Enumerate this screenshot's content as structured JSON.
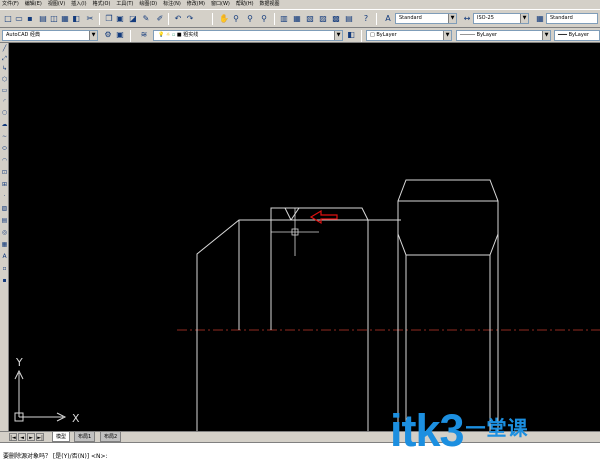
{
  "menu": [
    "文件(F)",
    "编辑(E)",
    "视图(V)",
    "插入(I)",
    "格式(O)",
    "工具(T)",
    "绘图(D)",
    "标注(N)",
    "修改(M)",
    "窗口(W)",
    "帮助(H)",
    "数据视图"
  ],
  "toolbar": {
    "text_style": "Standard",
    "dim_style": "ISO-25",
    "table_style": "Standard"
  },
  "toolbar2": {
    "workspace": "AutoCAD 经典",
    "layer": "粗实线",
    "color": "ByLayer",
    "linetype": "ByLayer",
    "lineweight": "ByLayer"
  },
  "ucs": {
    "x_label": "X",
    "y_label": "Y"
  },
  "tabs": {
    "model": "模型",
    "layout1": "布局1",
    "layout2": "布局2"
  },
  "nav": [
    "|◄",
    "◄",
    "►",
    "►|"
  ],
  "command": {
    "text": "要删除源对象吗？ [是(Y)/否(N)] <N>:"
  },
  "watermark": {
    "main": "itk3",
    "sub": "一堂课"
  },
  "colors": {
    "drawing_lines": "#d9d9d9",
    "centerline": "#c0392b",
    "arrow": "#e01010",
    "watermark": "#1c8fe0",
    "canvas_bg": "#000000"
  },
  "icons": {
    "toolbar": [
      "new-icon",
      "open-icon",
      "save-icon",
      "print-icon",
      "preview-icon",
      "plot-icon",
      "cut-icon",
      "copy-icon",
      "paste-icon",
      "match-icon",
      "brush-icon",
      "undo-icon",
      "redo-icon",
      "pan-icon",
      "zoom-icon",
      "zoom-window-icon",
      "zoom-prev-icon",
      "properties-icon",
      "design-center-icon",
      "tool-palette-icon",
      "sheet-set-icon",
      "markup-icon",
      "calc-icon",
      "help-icon"
    ],
    "left": [
      "line-icon",
      "xline-icon",
      "pline-icon",
      "polygon-icon",
      "rectangle-icon",
      "arc-icon",
      "circle-icon",
      "revcloud-icon",
      "spline-icon",
      "ellipse-icon",
      "ellipse-arc-icon",
      "insert-block-icon",
      "make-block-icon",
      "point-icon",
      "hatch-icon",
      "gradient-icon",
      "region-icon",
      "table-icon",
      "mtext-icon"
    ]
  }
}
